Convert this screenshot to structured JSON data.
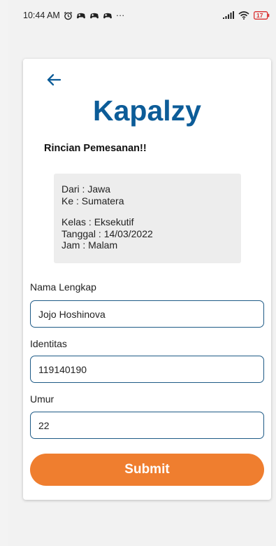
{
  "status_bar": {
    "time": "10:44 AM",
    "more": "···",
    "battery": "17"
  },
  "app": {
    "brand": "Kapalzy"
  },
  "booking": {
    "heading": "Rincian Pemesanan!!",
    "from": "Dari : Jawa",
    "to": "Ke : Sumatera",
    "class": "Kelas : Eksekutif",
    "date": "Tanggal : 14/03/2022",
    "time": "Jam : Malam"
  },
  "form": {
    "full_name": {
      "label": "Nama Lengkap",
      "value": "Jojo Hoshinova"
    },
    "identity": {
      "label": "Identitas",
      "value": "119140190"
    },
    "age": {
      "label": "Umur",
      "value": "22"
    },
    "submit_label": "Submit"
  },
  "colors": {
    "brand": "#0c5c98",
    "accent": "#ef7e2f",
    "input_border": "#1e5a86"
  },
  "icons": {
    "back": "arrow-left-icon",
    "alarm": "alarm-icon",
    "notifications": "game-controller-icon",
    "signal": "signal-icon",
    "wifi": "wifi-icon",
    "battery": "battery-icon"
  }
}
